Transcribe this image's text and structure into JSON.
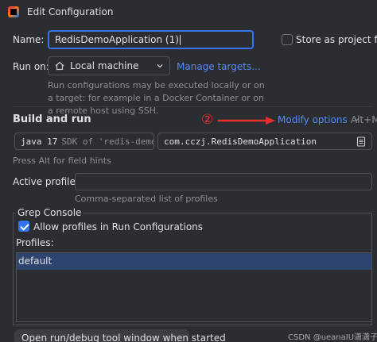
{
  "window": {
    "title": "Edit Configuration"
  },
  "form": {
    "name_label": "Name:",
    "name_value": "RedisDemoApplication (1)",
    "store_label": "Store as project file",
    "run_on_label": "Run on:",
    "run_on_value": "Local machine",
    "manage_targets": "Manage targets...",
    "run_on_hint": "Run configurations may be executed locally or on a target: for example in a Docker Container or on a remote host using SSH."
  },
  "build_run": {
    "title": "Build and run",
    "annotation_number": "②",
    "modify_options": "Modify options",
    "modify_shortcut": "Alt+M",
    "jdk_version": "java 17",
    "jdk_desc": "SDK of 'redis-demo'",
    "main_class": "com.cczj.RedisDemoApplication",
    "alt_hint": "Press Alt for field hints",
    "active_profiles_label": "Active profiles:",
    "active_profiles_value": "",
    "profiles_hint": "Comma-separated list of profiles"
  },
  "grep_console": {
    "title": "Grep Console",
    "allow_profiles_label": "Allow profiles in Run Configurations",
    "allow_profiles_checked": true,
    "profiles_label": "Profiles:",
    "profiles": [
      "default"
    ]
  },
  "banner": {
    "text": "Open run/debug tool window when started"
  },
  "watermark": "CSDN @ueanaIU潇潇子",
  "colors": {
    "accent": "#3574f0",
    "link": "#548af7",
    "annotation": "#e8312a",
    "background": "#2b2d30"
  }
}
